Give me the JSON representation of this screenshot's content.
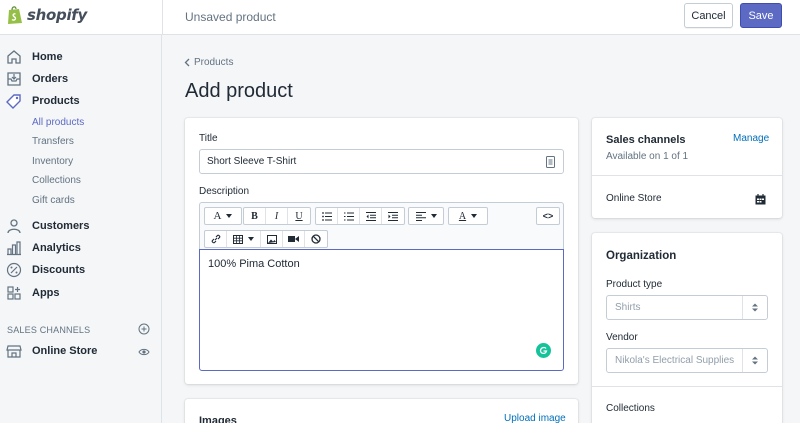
{
  "brand": {
    "name": "shopify"
  },
  "header": {
    "status": "Unsaved product",
    "cancel_label": "Cancel",
    "save_label": "Save"
  },
  "sidebar": {
    "items": [
      {
        "label": "Home",
        "icon": "home-icon"
      },
      {
        "label": "Orders",
        "icon": "orders-icon"
      },
      {
        "label": "Products",
        "icon": "tag-icon"
      }
    ],
    "product_subitems": [
      "All products",
      "Transfers",
      "Inventory",
      "Collections",
      "Gift cards"
    ],
    "items2": [
      {
        "label": "Customers",
        "icon": "customers-icon"
      },
      {
        "label": "Analytics",
        "icon": "analytics-icon"
      },
      {
        "label": "Discounts",
        "icon": "discount-icon"
      },
      {
        "label": "Apps",
        "icon": "apps-icon"
      }
    ],
    "channels_title": "SALES CHANNELS",
    "channels": [
      {
        "label": "Online Store",
        "icon": "store-icon"
      }
    ]
  },
  "main": {
    "breadcrumb": "Products",
    "title": "Add product",
    "title_label": "Title",
    "title_value": "Short Sleeve T-Shirt",
    "description_label": "Description",
    "description_value": "100% Pima Cotton",
    "toolbar": {
      "text_style": "A",
      "bold": "B",
      "italic": "I",
      "underline": "U",
      "color": "A",
      "html": "<>"
    },
    "images_title": "Images",
    "upload_label": "Upload image"
  },
  "channels_card": {
    "title": "Sales channels",
    "manage_label": "Manage",
    "availability": "Available on 1 of 1",
    "channel": "Online Store"
  },
  "organization": {
    "title": "Organization",
    "product_type_label": "Product type",
    "product_type_value": "Shirts",
    "vendor_label": "Vendor",
    "vendor_value": "Nikola's Electrical Supplies",
    "collections_label": "Collections"
  },
  "colors": {
    "accent": "#5c6ac4",
    "link": "#006fbb",
    "grammarly": "#15c39a"
  }
}
